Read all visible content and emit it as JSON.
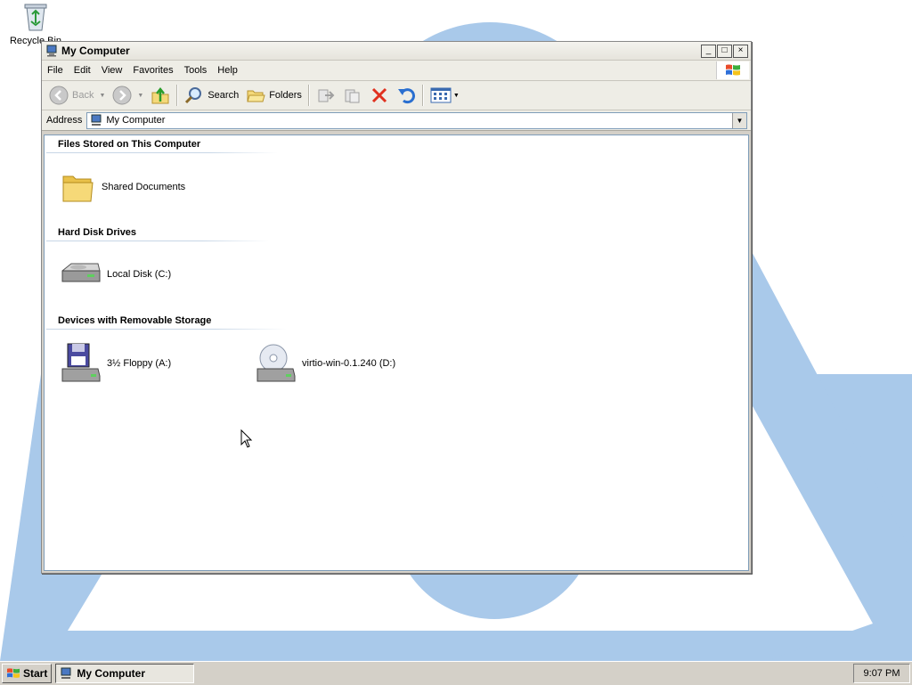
{
  "desktop": {
    "recycle_bin_label": "Recycle Bin",
    "wallpaper_color": "#a9c9ea"
  },
  "window": {
    "title": "My Computer",
    "controls": {
      "minimize": "_",
      "maximize": "□",
      "close": "×"
    }
  },
  "menubar": {
    "items": [
      "File",
      "Edit",
      "View",
      "Favorites",
      "Tools",
      "Help"
    ]
  },
  "toolbar": {
    "back_label": "Back",
    "search_label": "Search",
    "folders_label": "Folders"
  },
  "address": {
    "label": "Address",
    "value": "My Computer"
  },
  "content": {
    "groups": [
      {
        "title": "Files Stored on This Computer",
        "items": [
          {
            "label": "Shared Documents",
            "icon": "folder-icon"
          }
        ]
      },
      {
        "title": "Hard Disk Drives",
        "items": [
          {
            "label": "Local Disk (C:)",
            "icon": "hard-disk-icon"
          }
        ]
      },
      {
        "title": "Devices with Removable Storage",
        "items": [
          {
            "label": "3½ Floppy (A:)",
            "icon": "floppy-drive-icon"
          },
          {
            "label": "virtio-win-0.1.240 (D:)",
            "icon": "cd-drive-icon"
          }
        ]
      }
    ]
  },
  "taskbar": {
    "start_label": "Start",
    "task_label": "My Computer",
    "clock": "9:07 PM"
  }
}
